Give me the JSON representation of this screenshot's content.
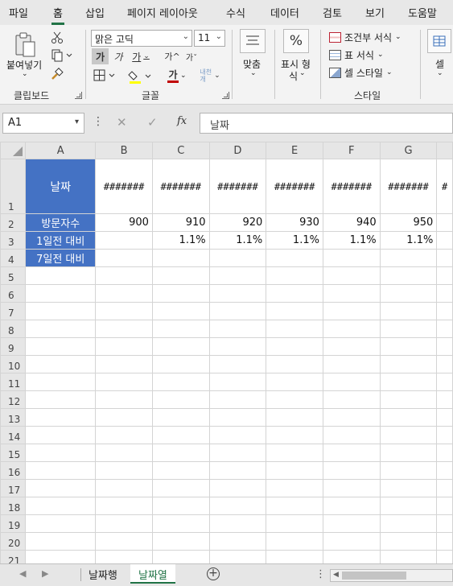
{
  "menu": {
    "tabs": [
      "파일",
      "홈",
      "삽입",
      "페이지 레이아웃",
      "수식",
      "데이터",
      "검토",
      "보기",
      "도움말"
    ],
    "active": "홈"
  },
  "ribbon": {
    "clipboard": {
      "paste_label": "붙여넣기",
      "group_label": "클립보드"
    },
    "font": {
      "family": "맑은 고딕",
      "size": "11",
      "group_label": "글꼴",
      "bold_glyph": "가",
      "italic_glyph": "가",
      "underline_glyph": "가",
      "grow_glyph": "가^",
      "shrink_glyph": "가ˇ",
      "color_glyph": "가",
      "phonetic_glyph": "내천\n개"
    },
    "alignment": {
      "label": "맞춤"
    },
    "number": {
      "percent_glyph": "%",
      "label_line1": "표시 형",
      "label_line2": "식"
    },
    "styles": {
      "conditional": "조건부 서식",
      "table": "표 서식",
      "cell": "셀 스타일",
      "group_label": "스타일"
    },
    "cells": {
      "label": "셀"
    }
  },
  "formula_bar": {
    "name_box": "A1",
    "fx": "fx",
    "content": "날짜"
  },
  "grid": {
    "columns": [
      "A",
      "B",
      "C",
      "D",
      "E",
      "F",
      "G"
    ],
    "rows": [
      {
        "num": "1",
        "cells": [
          "날짜",
          "#######",
          "#######",
          "#######",
          "#######",
          "#######",
          "#######"
        ]
      },
      {
        "num": "2",
        "cells": [
          "방문자수",
          "900",
          "910",
          "920",
          "930",
          "940",
          "950"
        ]
      },
      {
        "num": "3",
        "cells": [
          "1일전 대비",
          "",
          "1.1%",
          "1.1%",
          "1.1%",
          "1.1%",
          "1.1%"
        ]
      },
      {
        "num": "4",
        "cells": [
          "7일전 대비",
          "",
          "",
          "",
          "",
          "",
          ""
        ]
      }
    ],
    "empty_rows": [
      "5",
      "6",
      "7",
      "8",
      "9",
      "10",
      "11",
      "12",
      "13",
      "14",
      "15",
      "16",
      "17",
      "18",
      "19",
      "20",
      "21"
    ]
  },
  "sheets": {
    "tabs": [
      "날짜행",
      "날짜열"
    ],
    "active": "날짜열",
    "add_glyph": "+"
  },
  "colors": {
    "label_fill": "#4472c4",
    "accent": "#217346"
  }
}
